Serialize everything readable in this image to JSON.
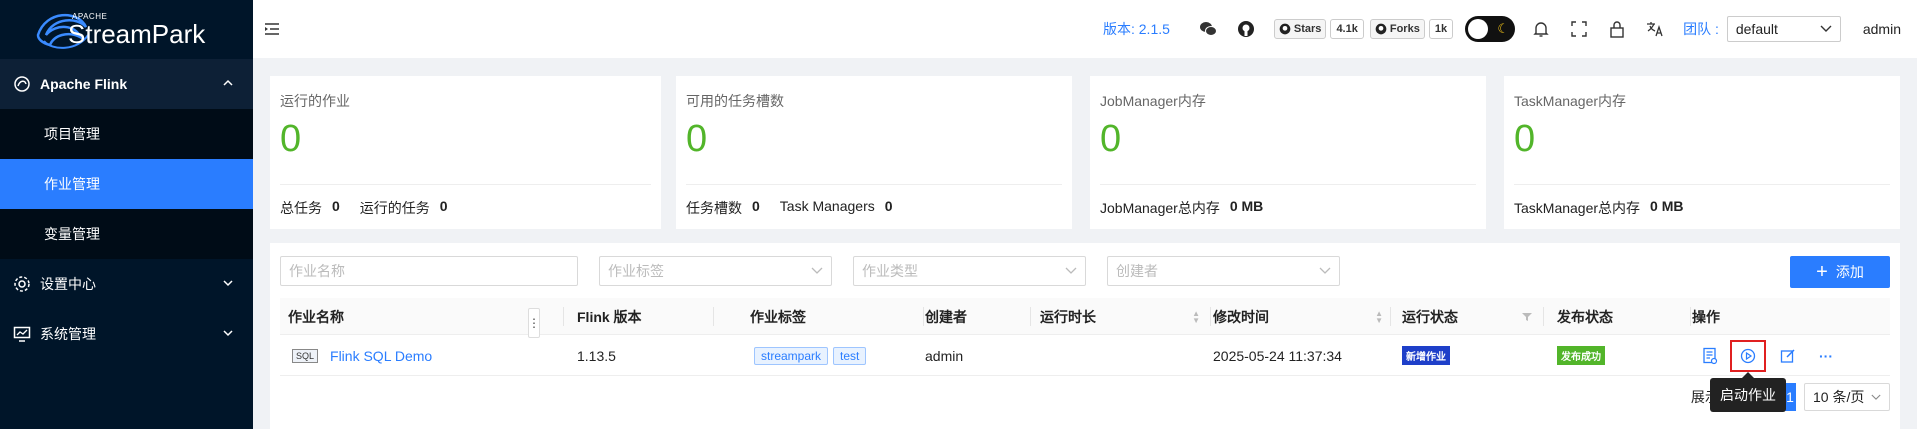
{
  "logo": {
    "small": "APACHE",
    "big": "StreamPark"
  },
  "sidebar": {
    "groups": [
      {
        "label": "Apache Flink",
        "icon": "flink-icon",
        "expanded": true,
        "items": [
          {
            "label": "项目管理",
            "active": false
          },
          {
            "label": "作业管理",
            "active": true
          },
          {
            "label": "变量管理",
            "active": false
          }
        ]
      },
      {
        "label": "设置中心",
        "icon": "gear-icon",
        "expanded": false
      },
      {
        "label": "系统管理",
        "icon": "monitor-icon",
        "expanded": false
      }
    ]
  },
  "header": {
    "version": "版本: 2.1.5",
    "github": {
      "stars_label": "Stars",
      "stars_count": "4.1k",
      "forks_label": "Forks",
      "forks_count": "1k"
    },
    "team_label": "团队 :",
    "team_value": "default",
    "user": "admin"
  },
  "cards": [
    {
      "title": "运行的作业",
      "value": "0",
      "foot": [
        {
          "label": "总任务",
          "value": "0"
        },
        {
          "label": "运行的任务",
          "value": "0"
        }
      ]
    },
    {
      "title": "可用的任务槽数",
      "value": "0",
      "foot": [
        {
          "label": "任务槽数",
          "value": "0"
        },
        {
          "label": "Task Managers",
          "value": "0"
        }
      ]
    },
    {
      "title": "JobManager内存",
      "value": "0",
      "foot": [
        {
          "label": "JobManager总内存",
          "value": "0 MB"
        }
      ]
    },
    {
      "title": "TaskManager内存",
      "value": "0",
      "foot": [
        {
          "label": "TaskManager总内存",
          "value": "0 MB"
        }
      ]
    }
  ],
  "filters": {
    "job_name_placeholder": "作业名称",
    "job_tag_placeholder": "作业标签",
    "job_type_placeholder": "作业类型",
    "creator_placeholder": "创建者",
    "add_label": "添加"
  },
  "table": {
    "columns": [
      "作业名称",
      "Flink 版本",
      "作业标签",
      "创建者",
      "运行时长",
      "修改时间",
      "运行状态",
      "发布状态",
      "操作"
    ],
    "rows": [
      {
        "type_badge": "SQL",
        "name": "Flink SQL Demo",
        "flink_version": "1.13.5",
        "tags": [
          "streampark",
          "test"
        ],
        "creator": "admin",
        "duration": "",
        "modified": "2025-05-24 11:37:34",
        "run_status": "新增作业",
        "release_status": "发布成功"
      }
    ]
  },
  "pagination": {
    "info": "展示 1~1 ,共 1",
    "page": "1",
    "page_size": "10 条/页"
  },
  "tooltip": "启动作业",
  "colors": {
    "accent": "#2a7dff",
    "sidebar": "#001529",
    "value_green": "#52b52a",
    "highlight_red": "#e02020"
  }
}
